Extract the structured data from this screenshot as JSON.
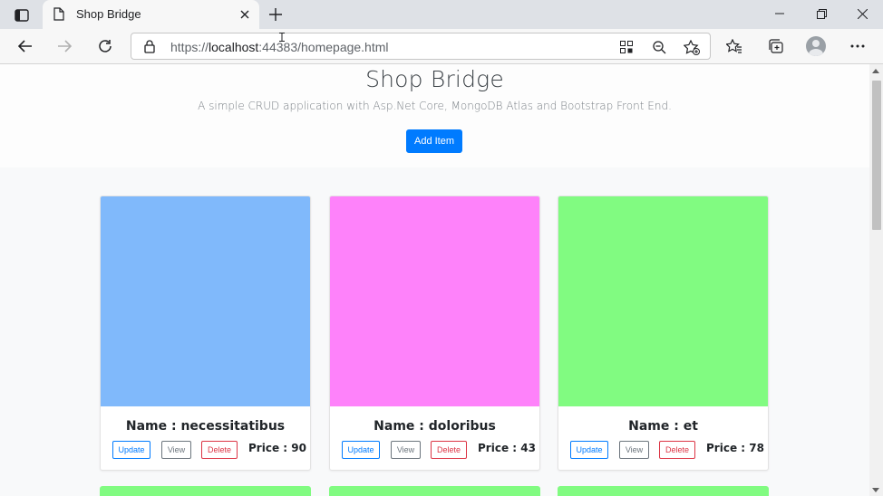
{
  "browser": {
    "tab_title": "Shop Bridge",
    "url_prefix": "https://",
    "url_host": "localhost",
    "url_rest": ":44383/homepage.html"
  },
  "page": {
    "title": "Shop Bridge",
    "subtitle": "A simple CRUD application with Asp.Net Core, MongoDB Atlas and Bootstrap Front End.",
    "add_button": "Add Item"
  },
  "cards": [
    {
      "name": "Name : necessitatibus",
      "price": "Price : 90",
      "color": "#80b9fb",
      "update": "Update",
      "view": "View",
      "delete": "Delete"
    },
    {
      "name": "Name : doloribus",
      "price": "Price : 43",
      "color": "#fe82fa",
      "update": "Update",
      "view": "View",
      "delete": "Delete"
    },
    {
      "name": "Name : et",
      "price": "Price : 78",
      "color": "#81fb81",
      "update": "Update",
      "view": "View",
      "delete": "Delete"
    }
  ],
  "next_row_colors": [
    "#81fb81",
    "#81fb81",
    "#81fb81"
  ],
  "colors": {
    "accent": "#007bff",
    "danger": "#dc3545",
    "secondary": "#6c757d"
  }
}
